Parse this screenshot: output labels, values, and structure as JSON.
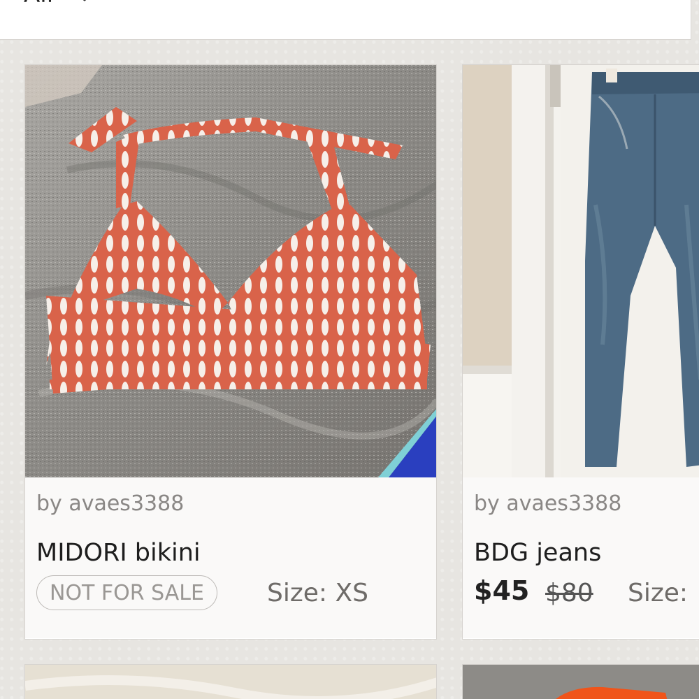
{
  "filter": {
    "label": "All",
    "icon": "chevron-down-icon"
  },
  "listings": [
    {
      "seller": "by avaes3388",
      "title": "MIDORI bikini",
      "status_badge": "NOT FOR SALE",
      "size": "Size: XS",
      "image": "orange-white-patterned-bikini-top-photo"
    },
    {
      "seller": "by avaes3388",
      "title": "BDG jeans",
      "price": "$45",
      "original_price": "$80",
      "size": "Size:",
      "image": "blue-jeans-on-door-photo"
    }
  ],
  "colors": {
    "background": "#e7e5e1",
    "card": "#ffffff",
    "seller_text": "#8a8785",
    "badge_border": "#bdbab7"
  }
}
